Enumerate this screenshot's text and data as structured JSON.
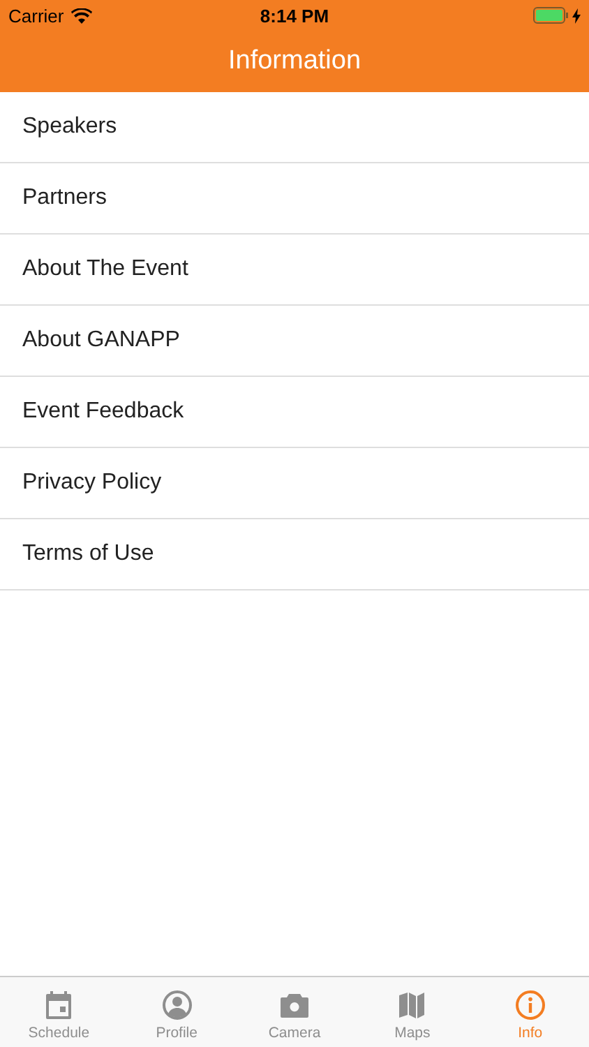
{
  "status_bar": {
    "carrier": "Carrier",
    "time": "8:14 PM"
  },
  "nav_bar": {
    "title": "Information"
  },
  "items": [
    {
      "label": "Speakers"
    },
    {
      "label": "Partners"
    },
    {
      "label": "About The Event"
    },
    {
      "label": "About GANAPP"
    },
    {
      "label": "Event Feedback"
    },
    {
      "label": "Privacy Policy"
    },
    {
      "label": "Terms of Use"
    }
  ],
  "tab_bar": [
    {
      "label": "Schedule",
      "selected": false
    },
    {
      "label": "Profile",
      "selected": false
    },
    {
      "label": "Camera",
      "selected": false
    },
    {
      "label": "Maps",
      "selected": false
    },
    {
      "label": "Info",
      "selected": true
    }
  ]
}
